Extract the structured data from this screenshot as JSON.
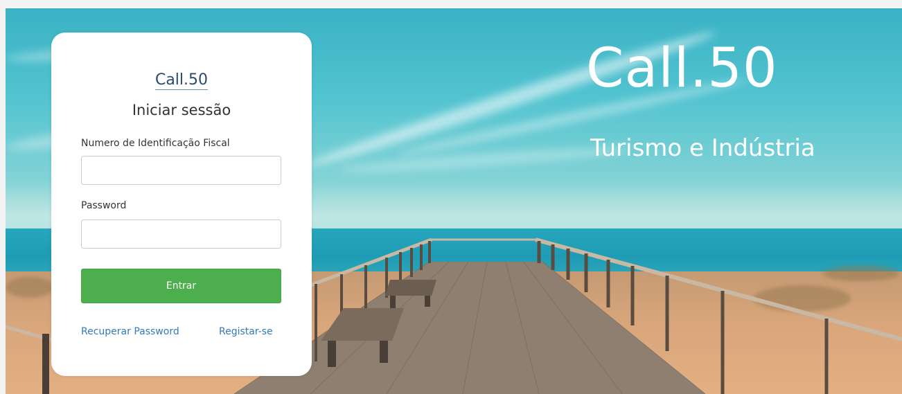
{
  "brand": {
    "title": "Call.50",
    "subtitle": "Turismo e Indústria"
  },
  "login": {
    "logo_text": "Call.50",
    "heading": "Iniciar sessão",
    "nif_label": "Numero de Identificação Fiscal",
    "nif_value": "",
    "password_label": "Password",
    "password_value": "",
    "submit_label": "Entrar",
    "recover_link": "Recuperar Password",
    "register_link": "Registar-se"
  },
  "colors": {
    "primary_button": "#4cae4c",
    "link": "#337ab7",
    "logo": "#2b4a6e"
  }
}
